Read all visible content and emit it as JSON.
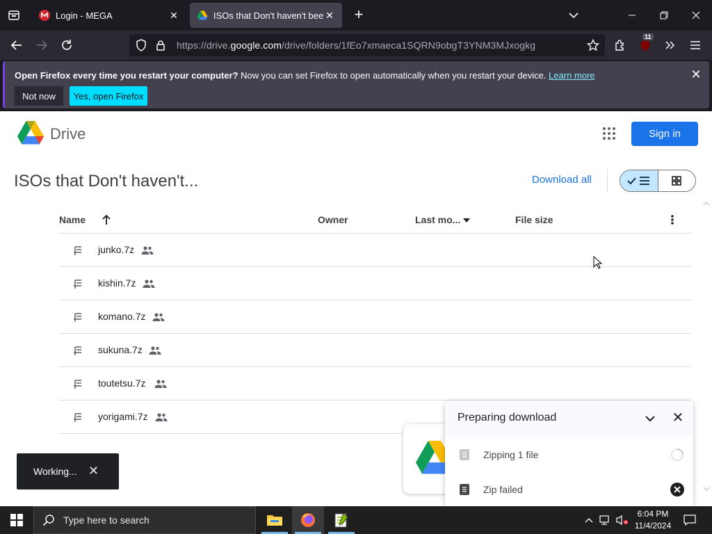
{
  "browser": {
    "tabs": [
      {
        "title": "Login - MEGA",
        "active": false
      },
      {
        "title": "ISOs that Don't haven't been up",
        "active": true
      }
    ],
    "url": {
      "prefix": "https://drive.",
      "domain": "google.com",
      "path": "/drive/folders/1fEo7xmaeca1SQRN9obgT3YNM3MJxogkg"
    },
    "extension_badge": "11"
  },
  "notification": {
    "bold": "Open Firefox every time you restart your computer?",
    "text": " Now you can set Firefox to open automatically when you restart your device. ",
    "link": "Learn more",
    "btn_not_now": "Not now",
    "btn_yes": "Yes, open Firefox"
  },
  "drive": {
    "brand": "Drive",
    "sign_in": "Sign in",
    "folder_title": "ISOs that Don't haven't...",
    "download_all": "Download all",
    "columns": {
      "name": "Name",
      "owner": "Owner",
      "last_modified": "Last mo...",
      "file_size": "File size"
    },
    "files": [
      {
        "name": "junko.7z"
      },
      {
        "name": "kishin.7z"
      },
      {
        "name": "komano.7z"
      },
      {
        "name": "sukuna.7z"
      },
      {
        "name": "toutetsu.7z"
      },
      {
        "name": "yorigami.7z"
      }
    ]
  },
  "snackbar": {
    "text": "Working..."
  },
  "download_panel": {
    "title": "Preparing download",
    "items": [
      {
        "text": "Zipping 1 file",
        "status": "in-progress"
      },
      {
        "text": "Zip failed",
        "status": "failed"
      }
    ]
  },
  "taskbar": {
    "search_placeholder": "Type here to search",
    "time": "6:04 PM",
    "date": "11/4/2024"
  },
  "colors": {
    "accent": "#1a73e8",
    "firefox_cta": "#00ddff",
    "toggle_active": "#c2e7ff"
  }
}
